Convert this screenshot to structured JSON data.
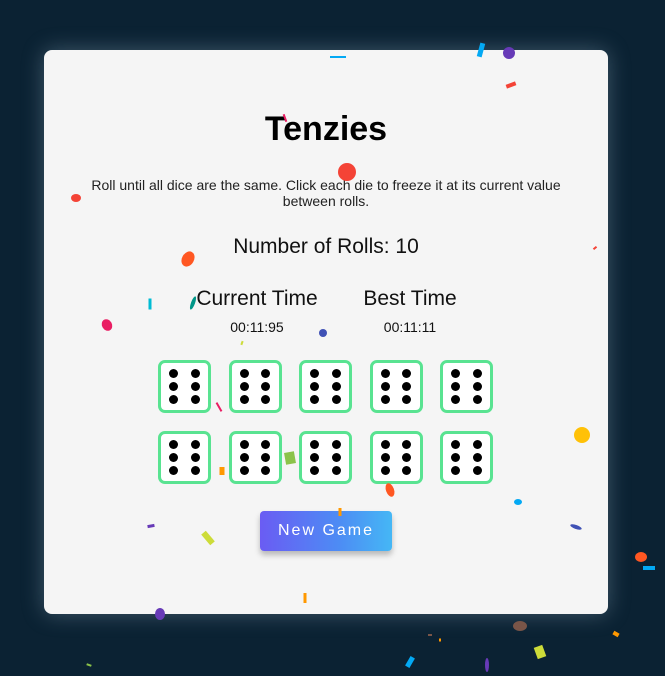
{
  "game": {
    "title": "Tenzies",
    "instructions": "Roll until all dice are the same. Click each die to freeze it at its current value between rolls.",
    "rolls_text": "Number of Rolls: 10",
    "current_time_label": "Current Time",
    "current_time_value": "00:11:95",
    "best_time_label": "Best Time",
    "best_time_value": "00:11:11",
    "new_game_label": "New Game",
    "dice": [
      6,
      6,
      6,
      6,
      6,
      6,
      6,
      6,
      6,
      6
    ],
    "dice_held": [
      true,
      true,
      true,
      true,
      true,
      true,
      true,
      true,
      true,
      true
    ]
  },
  "colors": {
    "background": "#0b2233",
    "card": "#f5f5f5",
    "die_border_held": "#59e391",
    "button_gradient_start": "#6a5cf3",
    "button_gradient_end": "#45b7f5"
  },
  "confetti_colors": [
    "#f44336",
    "#ff5722",
    "#ffc107",
    "#e91e63",
    "#673ab7",
    "#3f51b5",
    "#03a9f4",
    "#00bcd4",
    "#009688",
    "#8bc34a",
    "#cddc39",
    "#ff9800",
    "#795548"
  ]
}
